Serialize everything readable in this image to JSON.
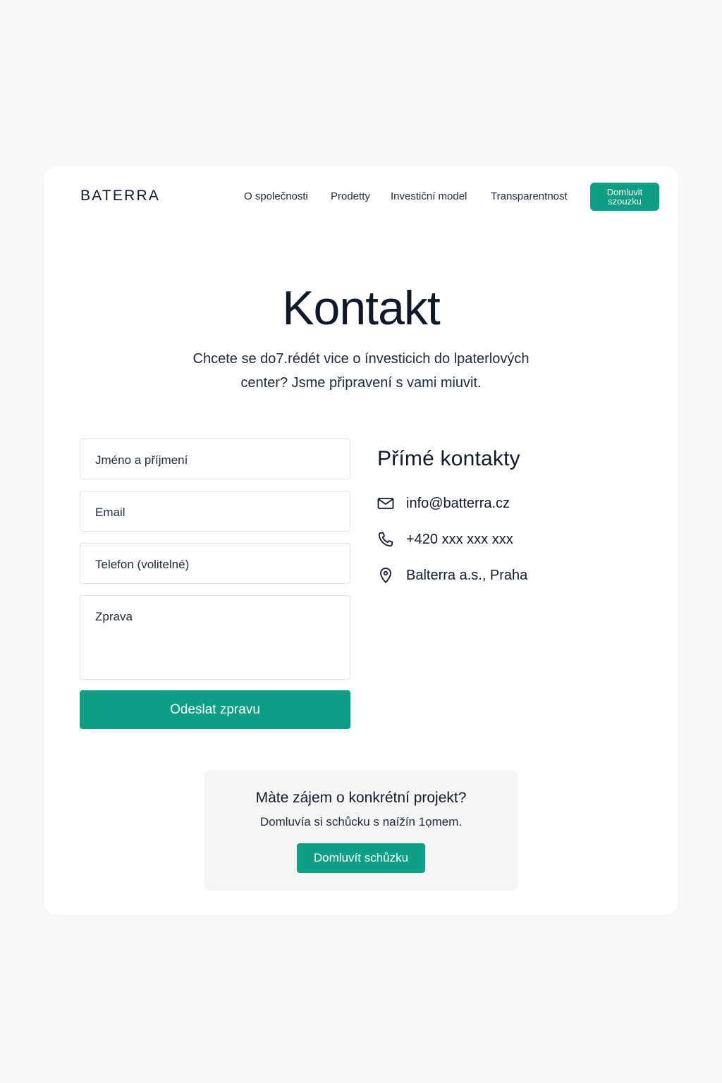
{
  "brand": {
    "logo": "BATERRA"
  },
  "nav": {
    "items": [
      "O společnosti",
      "Prodetty",
      "Investiční model",
      "Transparentnost"
    ],
    "cta_label": "Domluvit\nszouzku"
  },
  "hero": {
    "title": "Kontakt",
    "intro_line_1": "Chcete se do7.rédét vice o ínvesticich do lpaterlových",
    "intro_line_2": "center? Jsme připravení s vami miuvit."
  },
  "form": {
    "name_placeholder": "Jméno a příjmení",
    "email_placeholder": "Email",
    "phone_placeholder": "Telefon (volitelné)",
    "message_placeholder": "Zprava",
    "submit_label": "Odeslat zpravu"
  },
  "contacts": {
    "title": "Přímé kontakty",
    "items": [
      {
        "icon": "mail-icon",
        "text": "info@batterra.cz"
      },
      {
        "icon": "phone-icon",
        "text": "+420 xxx xxx xxx"
      },
      {
        "icon": "location-pin-icon",
        "text": "Balterra a.s., Praha"
      }
    ]
  },
  "cta": {
    "title": "Màte zájem o konkrétní projekt?",
    "text": "Domluvía si schůcku s naížín 1ọmem.",
    "button_label": "Domluvít schůzku"
  },
  "colors": {
    "accent": "#0c9f86",
    "page_bg": "#f8f8f8",
    "card_bg": "#ffffff",
    "cta_bg": "#f5f5f5"
  }
}
